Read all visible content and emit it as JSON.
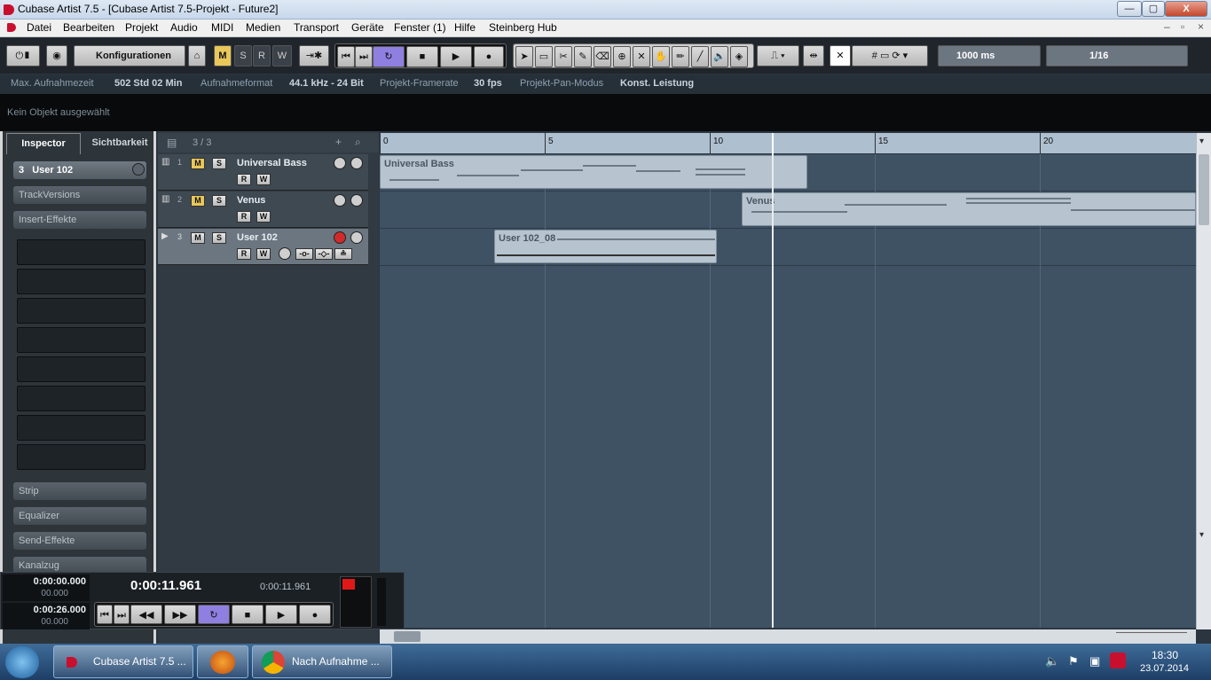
{
  "window": {
    "title": "Cubase Artist 7.5 - [Cubase Artist 7.5-Projekt - Future2]",
    "min": "—",
    "max": "▢",
    "close": "X"
  },
  "menu": [
    "Datei",
    "Bearbeiten",
    "Projekt",
    "Audio",
    "MIDI",
    "Medien",
    "Transport",
    "Geräte",
    "Fenster (1)",
    "Hilfe",
    "Steinberg Hub"
  ],
  "toolbar": {
    "config_label": "Konfigurationen",
    "modes": [
      "M",
      "S",
      "R",
      "W"
    ],
    "time": "1000 ms",
    "quantize": "1/16"
  },
  "info": [
    {
      "label": "Max. Aufnahmezeit",
      "value": "502 Std 02 Min"
    },
    {
      "label": "Aufnahmeformat",
      "value": "44.1 kHz - 24 Bit"
    },
    {
      "label": "Projekt-Framerate",
      "value": "30 fps"
    },
    {
      "label": "Projekt-Pan-Modus",
      "value": "Konst. Leistung"
    }
  ],
  "selection": "Kein Objekt ausgewählt",
  "inspector": {
    "tabs": [
      "Inspector",
      "Sichtbarkeit"
    ],
    "track_num": "3",
    "track_name": "User 102",
    "sections": [
      "TrackVersions",
      "Insert-Effekte"
    ],
    "bottom_sections": [
      "Strip",
      "Equalizer",
      "Send-Effekte",
      "Kanalzug"
    ]
  },
  "tracklist": {
    "count": "3 / 3",
    "tracks": [
      {
        "num": "1",
        "name": "Universal Bass"
      },
      {
        "num": "2",
        "name": "Venus"
      },
      {
        "num": "3",
        "name": "User 102"
      }
    ]
  },
  "ruler": [
    "0",
    "5",
    "10",
    "15",
    "20"
  ],
  "parts": [
    {
      "name": "Universal Bass"
    },
    {
      "name": "Venus"
    },
    {
      "name": "User 102_08"
    }
  ],
  "transport": {
    "left_locator": "0:00:00.000",
    "left_sub": "00.000",
    "right_locator": "0:00:26.000",
    "right_sub": "00.000",
    "position": "0:00:11.961",
    "secondary": "0:00:11.961"
  },
  "taskbar": {
    "items": [
      "Cubase Artist 7.5 ...",
      "Nach Aufnahme ..."
    ],
    "time": "18:30",
    "date": "23.07.2014"
  }
}
